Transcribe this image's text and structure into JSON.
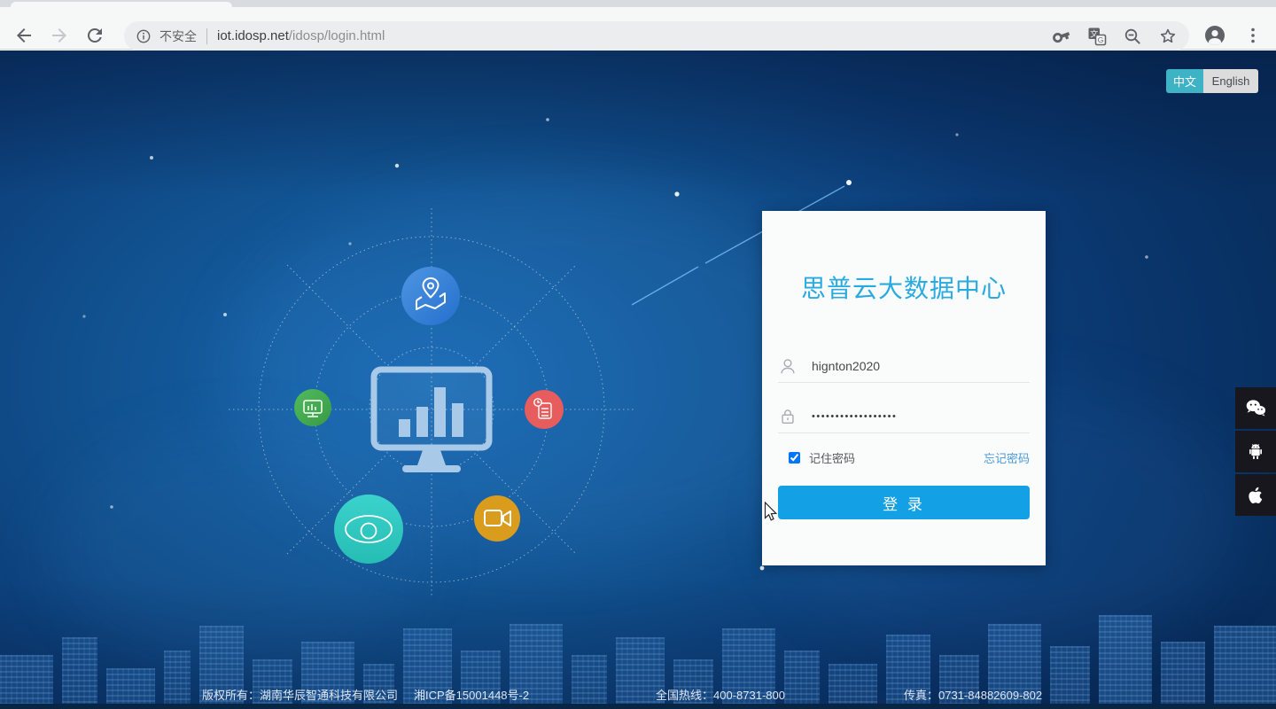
{
  "browser": {
    "security_label": "不安全",
    "url_host": "iot.idosp.net",
    "url_path": "/idosp/login.html"
  },
  "language_toggle": {
    "chinese_label": "中文",
    "english_label": "English",
    "active": "chinese"
  },
  "login": {
    "title": "思普云大数据中心",
    "username_value": "hignton2020",
    "password_value": "••••••••••••••••••",
    "remember_label": "记住密码",
    "remember_checked": "checked",
    "forgot_label": "忘记密码",
    "submit_label": "登 录"
  },
  "footer": {
    "copyright": "版权所有：湖南华辰智通科技有限公司",
    "icp": "湘ICP备15001448号-2",
    "hotline": "全国热线：400-8731-800",
    "fax": "传真：0731-84882609-802"
  },
  "diagram": {
    "center_icon": "dashboard-monitor-icon",
    "satellite_icons": [
      "map-pin-icon",
      "monitor-chart-icon",
      "report-icon",
      "eye-icon",
      "video-camera-icon"
    ]
  },
  "social_icons": [
    "wechat-icon",
    "android-icon",
    "apple-icon"
  ],
  "colors": {
    "accent_blue": "#29aae1",
    "button_blue": "#14a0e4",
    "toggle_teal": "#3eb3c6",
    "link_blue": "#4a9ad8",
    "page_navy": "#0b3a74",
    "satellite_green": "#43a94e",
    "satellite_red": "#e75c5c",
    "satellite_teal": "#2fc8c3",
    "satellite_orange": "#d99c1c",
    "satellite_blue": "#3a86d9"
  }
}
